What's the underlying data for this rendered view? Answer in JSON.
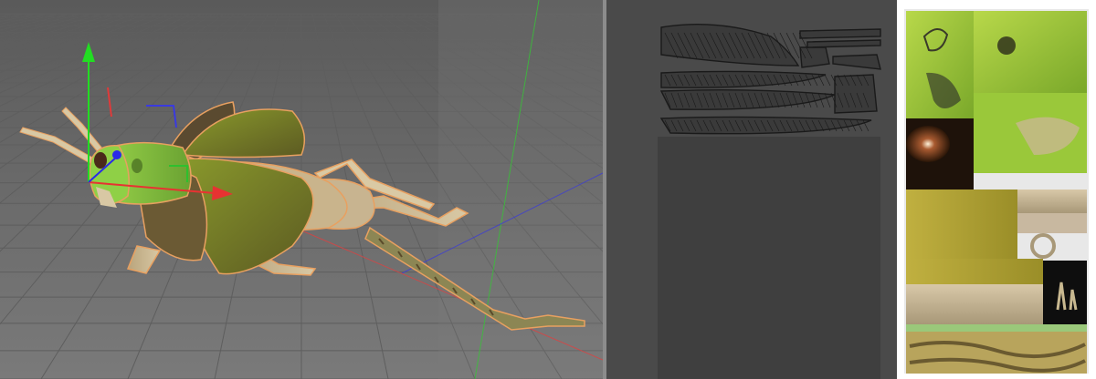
{
  "app": {
    "title": ""
  },
  "panels": {
    "viewport": {
      "name": "3d-viewport",
      "subject": "grasshopper"
    },
    "uv_editor": {
      "name": "uv-editor"
    },
    "texture_atlas": {
      "name": "texture-atlas"
    }
  },
  "colors": {
    "viewport_bg": "#6f6f6f",
    "grid_line": "#5e5e5e",
    "uv_bg": "#4a4a4a",
    "uv_canvas": "#3f3f3f",
    "axis_x": "#e03a3a",
    "axis_y": "#2ed12e",
    "axis_z": "#3a3ae0",
    "selection_outline": "#e8a060",
    "insect_green": "#7fc23a",
    "wing_brown": "#6b5a34",
    "leg_tan": "#c7b48e"
  },
  "icons": {
    "move_gizmo": "move-gizmo-icon",
    "rotate_gizmo": "rotate-gizmo-icon"
  }
}
